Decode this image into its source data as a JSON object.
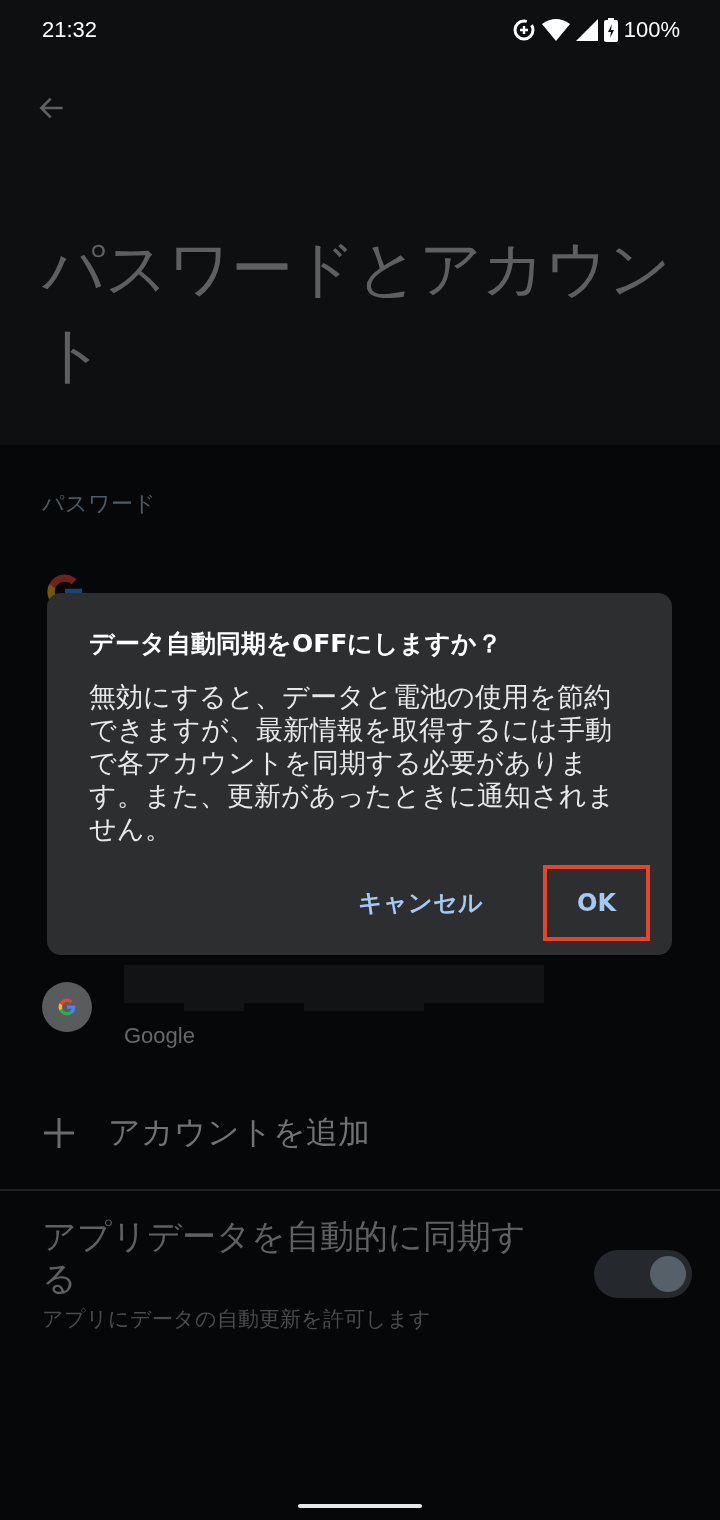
{
  "status_bar": {
    "time": "21:32",
    "battery": "100%"
  },
  "page": {
    "title": "パスワードとアカウント"
  },
  "passwords": {
    "header": "パスワード"
  },
  "accounts": {
    "items": [
      {
        "provider": "Google"
      }
    ],
    "add_label": "アカウントを追加"
  },
  "sync": {
    "title": "アプリデータを自動的に同期する",
    "subtitle": "アプリにデータの自動更新を許可します",
    "on": true
  },
  "dialog": {
    "title": "データ自動同期をOFFにしますか？",
    "message": "無効にすると、データと電池の使用を節約できますが、最新情報を取得するには手動で各アカウントを同期する必要があります。また、更新があったときに通知されません。",
    "buttons": [
      {
        "label": "キャンセル",
        "highlighted": false
      },
      {
        "label": "OK",
        "highlighted": true
      }
    ]
  }
}
